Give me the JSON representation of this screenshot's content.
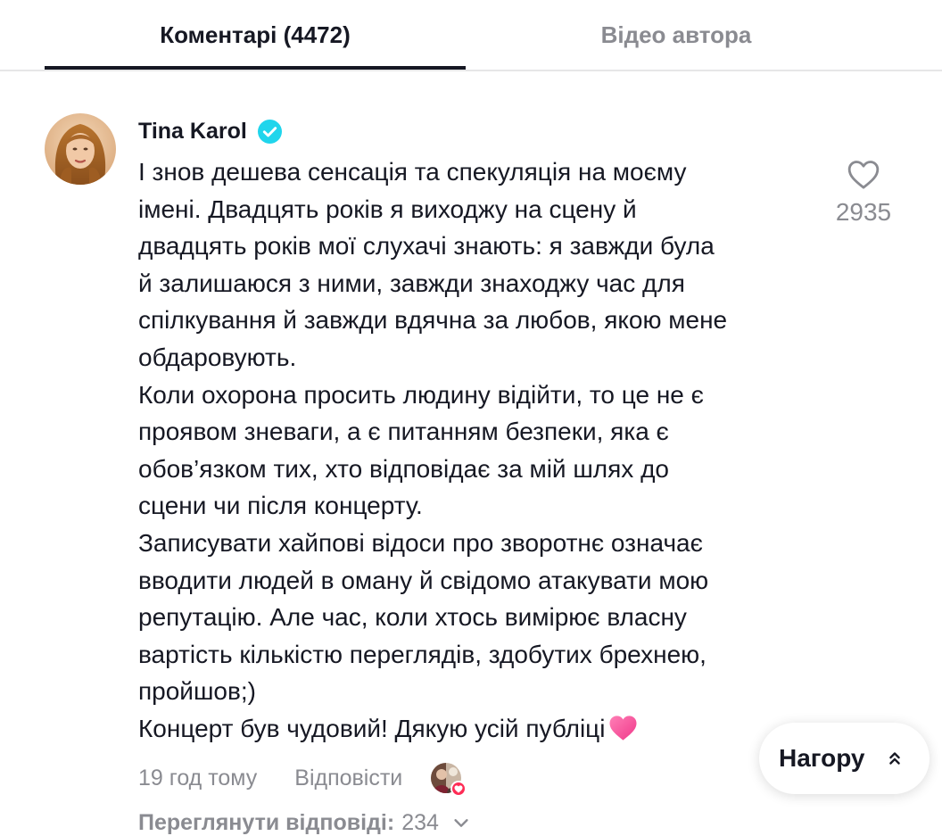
{
  "tabs": [
    {
      "label": "Коментарі (4472)",
      "active": true
    },
    {
      "label": "Відео автора",
      "active": false
    }
  ],
  "comment": {
    "author": "Tina Karol",
    "verified": true,
    "lines": [
      "І знов дешева сенсація та спекуляція на моєму",
      "імені. Двадцять років я виходжу на сцену й",
      "двадцять років мої слухачі знають: я завжди була",
      "й залишаюся з ними, завжди знаходжу час для",
      "спілкування й завжди вдячна за любов, якою мене",
      "обдаровують.",
      "Коли охорона просить людину відійти, то це не є",
      "проявом зневаги, а є питанням безпеки, яка є",
      "обов’язком тих, хто відповідає за мій шлях до",
      "сцени чи після концерту.",
      "Записувати хайпові відоси про зворотнє означає",
      "вводити людей в оману й свідомо атакувати мою",
      "репутацію. Але час, коли хтось вимірює власну",
      "вартість кількістю переглядів, здобутих брехнею,",
      "пройшов;)",
      "Концерт був чудовий! Дякую усій публіці"
    ],
    "like_count": "2935",
    "timestamp": "19 год тому",
    "reply_label": "Відповісти",
    "view_replies_label": "Переглянути відповіді:",
    "view_replies_count": "234"
  },
  "scroll_top_button": {
    "label": "Нагору"
  },
  "colors": {
    "text_primary": "#161823",
    "text_secondary": "#8a8b91",
    "verified_blue": "#20d5ec",
    "heart_pink": "#fe2c55",
    "divider": "#e6e6e7"
  },
  "icons": [
    "verified-badge-icon",
    "heart-outline-icon",
    "pink-heart-emoji-icon",
    "creator-liked-heart-icon",
    "chevron-down-icon",
    "double-chevron-up-icon"
  ]
}
